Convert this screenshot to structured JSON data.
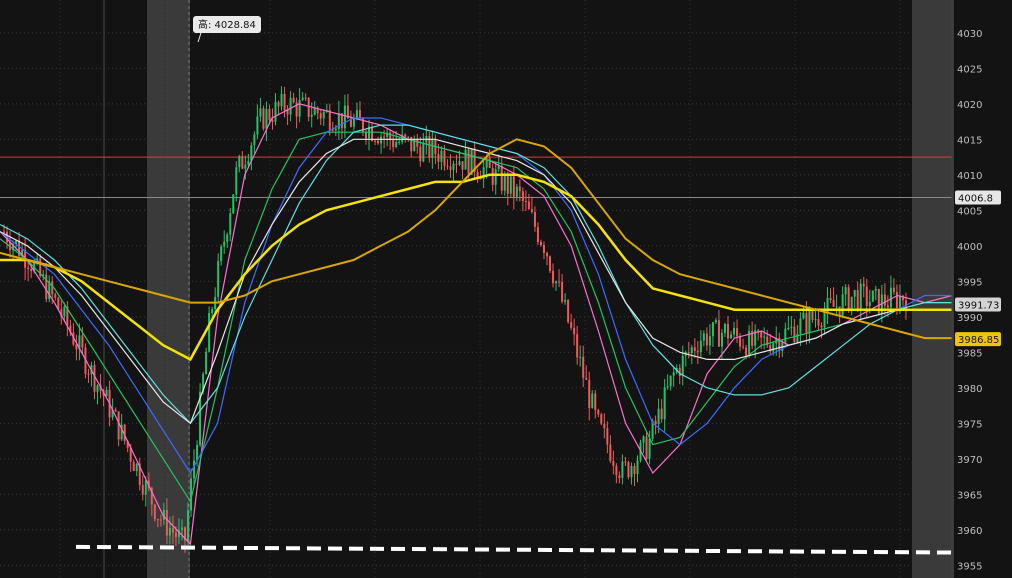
{
  "chart_data": {
    "type": "line",
    "ylim": [
      3954,
      4034
    ],
    "ticks": [
      3955,
      3960,
      3965,
      3970,
      3975,
      3980,
      3985,
      3990,
      3995,
      4000,
      4005,
      4010,
      4015,
      4020,
      4025,
      4030
    ],
    "grid": true,
    "annotations": {
      "high_label": "高: 4028.84",
      "high_value": 4028.84,
      "price_badges": [
        {
          "label": "4006.8",
          "value": 4006.8,
          "bg": "#e6e6e6",
          "fg": "#111111"
        },
        {
          "label": "3991.73",
          "value": 3991.73,
          "bg": "#d4d4d4",
          "fg": "#111111"
        },
        {
          "label": "3986.85",
          "value": 3986.85,
          "bg": "#f2c500",
          "fg": "#111111"
        }
      ],
      "horizontal_lines": [
        {
          "value": 4012.5,
          "color": "#e03b3b"
        },
        {
          "value": 4006.8,
          "color": "#8a8a8a"
        }
      ],
      "support_line": {
        "from": 3957.6,
        "to": 3956.8,
        "color": "#ffffff"
      }
    },
    "series": [
      {
        "color": "#ff6fcf",
        "values": [
          4002,
          3998,
          3992,
          3985,
          3978,
          3970,
          3962,
          3958,
          3990,
          4010,
          4018,
          4020,
          4019,
          4018,
          4017,
          4015,
          4014,
          4013,
          4012,
          4010,
          4007,
          4000,
          3988,
          3975,
          3968,
          3972,
          3982,
          3987,
          3988,
          3986,
          3987,
          3989,
          3991,
          3993,
          3992,
          3993
        ]
      },
      {
        "color": "#22c55e",
        "values": [
          4001,
          3998,
          3994,
          3988,
          3982,
          3976,
          3970,
          3964,
          3980,
          3998,
          4008,
          4015,
          4016,
          4016,
          4016,
          4015,
          4014,
          4013,
          4012,
          4011,
          4008,
          4002,
          3992,
          3980,
          3972,
          3973,
          3978,
          3983,
          3986,
          3987,
          3988,
          3989,
          3990,
          3991,
          3992,
          3992
        ]
      },
      {
        "color": "#3b6cff",
        "values": [
          4002,
          3999,
          3996,
          3991,
          3986,
          3980,
          3974,
          3968,
          3975,
          3992,
          4003,
          4011,
          4016,
          4018,
          4018,
          4017,
          4016,
          4015,
          4014,
          4013,
          4010,
          4005,
          3996,
          3984,
          3975,
          3972,
          3975,
          3980,
          3984,
          3986,
          3987,
          3989,
          3990,
          3991,
          3993,
          3993
        ]
      },
      {
        "color": "#5fe0e0",
        "values": [
          4003,
          4001,
          3998,
          3994,
          3989,
          3984,
          3979,
          3975,
          3980,
          3990,
          3998,
          4006,
          4012,
          4016,
          4017,
          4017,
          4016,
          4015,
          4014,
          4013,
          4011,
          4007,
          4000,
          3992,
          3986,
          3982,
          3980,
          3979,
          3979,
          3980,
          3983,
          3986,
          3989,
          3991,
          3992,
          3992
        ]
      },
      {
        "color": "#e8e8e8",
        "values": [
          4002,
          4000,
          3997,
          3993,
          3988,
          3983,
          3978,
          3975,
          3985,
          3996,
          4003,
          4009,
          4013,
          4015,
          4015,
          4015,
          4015,
          4014,
          4013,
          4012,
          4010,
          4006,
          3999,
          3992,
          3987,
          3985,
          3984,
          3984,
          3985,
          3986,
          3987,
          3989,
          3990,
          3991,
          3991,
          3991
        ]
      },
      {
        "color": "#f5e300",
        "width": 2.5,
        "values": [
          3998,
          3998,
          3997,
          3995,
          3992,
          3989,
          3986,
          3984,
          3991,
          3996,
          4000,
          4003,
          4005,
          4006,
          4007,
          4008,
          4009,
          4009,
          4010,
          4010,
          4009,
          4007,
          4003,
          3998,
          3994,
          3993,
          3992,
          3991,
          3991,
          3991,
          3991,
          3991,
          3991,
          3991,
          3991,
          3991
        ]
      },
      {
        "color": "#d9a800",
        "width": 2,
        "values": [
          3999,
          3998,
          3997,
          3996,
          3995,
          3994,
          3993,
          3992,
          3992,
          3993,
          3995,
          3996,
          3997,
          3998,
          4000,
          4002,
          4005,
          4009,
          4013,
          4015,
          4014,
          4011,
          4006,
          4001,
          3998,
          3996,
          3995,
          3994,
          3993,
          3992,
          3991,
          3990,
          3989,
          3988,
          3987,
          3987
        ]
      }
    ]
  }
}
